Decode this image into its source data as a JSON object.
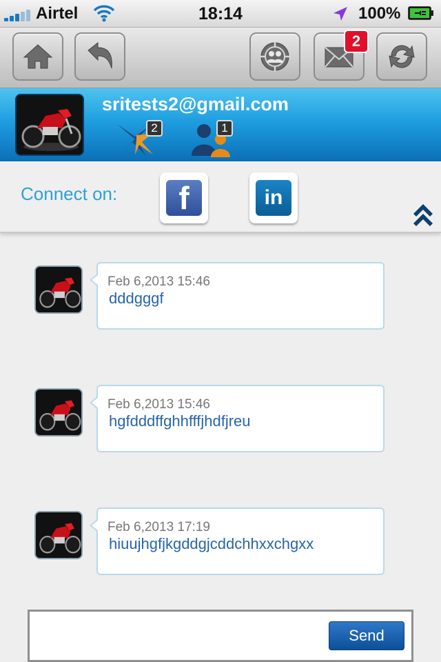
{
  "status_bar": {
    "carrier": "Airtel",
    "time": "18:14",
    "battery": "100%"
  },
  "toolbar": {
    "home_icon": "home-icon",
    "back_icon": "back-arrow-icon",
    "contacts_icon": "group-target-icon",
    "mail_icon": "envelope-icon",
    "mail_badge": "2",
    "refresh_icon": "refresh-icon"
  },
  "profile": {
    "email": "sritests2@gmail.com",
    "network_count": "2",
    "friends_count": "1"
  },
  "connect": {
    "label": "Connect on:",
    "facebook_glyph": "f",
    "linkedin_glyph": "in"
  },
  "messages": [
    {
      "timestamp": "Feb 6,2013 15:46",
      "text": "dddgggf"
    },
    {
      "timestamp": "Feb 6,2013 15:46",
      "text": "hgfdddffghhfffjhdfjreu"
    },
    {
      "timestamp": "Feb 6,2013 17:19",
      "text": "hiuujhgfjkgddgjcddchhxxchgxx"
    }
  ],
  "compose": {
    "value": "",
    "send_label": "Send"
  },
  "colors": {
    "accent_blue": "#1f9ee0",
    "message_text": "#2765a8",
    "badge_red": "#e0102a"
  }
}
